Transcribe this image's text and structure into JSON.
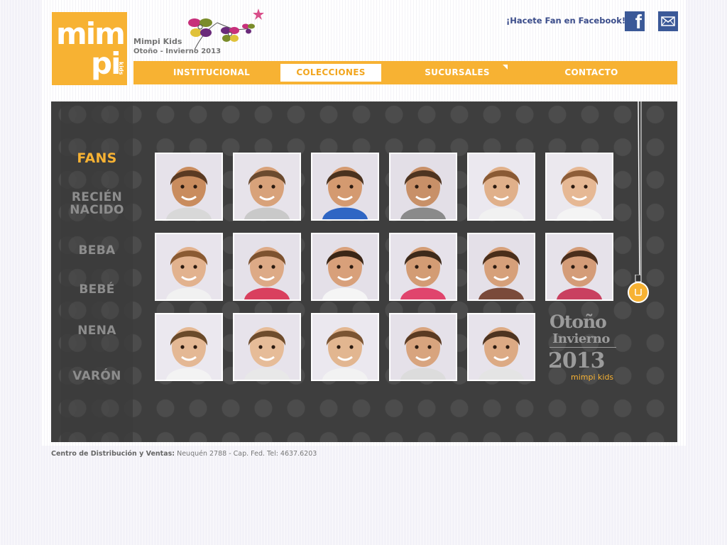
{
  "brand": {
    "logo_top": "mim",
    "logo_bottom": "pi",
    "logo_kids": "kids",
    "name": "Mimpi Kids",
    "season": "Otoño - Invierno 2013"
  },
  "social": {
    "facebook_text": "¡Hacete Fan en Facebook!",
    "facebook_icon": "f"
  },
  "nav": {
    "items": [
      {
        "label": "INSTITUCIONAL"
      },
      {
        "label": "COLECCIONES"
      },
      {
        "label": "SUCURSALES"
      },
      {
        "label": "CONTACTO"
      }
    ],
    "active_index": 1
  },
  "sidebar": {
    "items": [
      {
        "label": "FANS"
      },
      {
        "label": "RECIÉN"
      },
      {
        "label": "NACIDO"
      },
      {
        "label": "BEBA"
      },
      {
        "label": "BEBÉ"
      },
      {
        "label": "NENA"
      },
      {
        "label": "VARÓN"
      }
    ],
    "active_index": 0
  },
  "gallery": {
    "rows": 3,
    "photos": [
      {
        "tone": "#c98c5e",
        "hair": "#5a3a22",
        "bg": "#e6e2ea",
        "shirt": "#d8d8d8"
      },
      {
        "tone": "#d8a27a",
        "hair": "#6b4a2e",
        "bg": "#e7e3ea",
        "shirt": "#c9c9c9"
      },
      {
        "tone": "#d49a70",
        "hair": "#4a321e",
        "bg": "#e4e0e8",
        "shirt": "#2f66c4"
      },
      {
        "tone": "#c89068",
        "hair": "#4e3420",
        "bg": "#e3dfe7",
        "shirt": "#8a8a8a"
      },
      {
        "tone": "#e0b08a",
        "hair": "#8a5a34",
        "bg": "#ebe8ef",
        "shirt": "#f1f1f1"
      },
      {
        "tone": "#e6b894",
        "hair": "#8d5d38",
        "bg": "#ebe8ee",
        "shirt": "#f4f4f4"
      },
      {
        "tone": "#e2b28e",
        "hair": "#8a5a32",
        "bg": "#e8e4ec",
        "shirt": "#f1f1f1"
      },
      {
        "tone": "#ddaa86",
        "hair": "#7d522f",
        "bg": "#e5e1e9",
        "shirt": "#d9405e"
      },
      {
        "tone": "#d8a07a",
        "hair": "#3a2616",
        "bg": "#e4e0e8",
        "shirt": "#f5f5f5"
      },
      {
        "tone": "#d39c74",
        "hair": "#3e2a1a",
        "bg": "#e6e2ea",
        "shirt": "#e0456d"
      },
      {
        "tone": "#d6a07a",
        "hair": "#4a2e1a",
        "bg": "#e4e0e8",
        "shirt": "#7a4a3a"
      },
      {
        "tone": "#d49c78",
        "hair": "#4a2e1c",
        "bg": "#e6e2ea",
        "shirt": "#c94060"
      },
      {
        "tone": "#e4b894",
        "hair": "#6a4a2a",
        "bg": "#ebe8ef",
        "shirt": "#f3f3f3"
      },
      {
        "tone": "#e6bc98",
        "hair": "#6e4c2c",
        "bg": "#e7e3eb",
        "shirt": "#e8e8e8"
      },
      {
        "tone": "#e2b690",
        "hair": "#7a5432",
        "bg": "#ebe8ef",
        "shirt": "#f2f2f2"
      },
      {
        "tone": "#d8a47e",
        "hair": "#5a3a22",
        "bg": "#e5e1e9",
        "shirt": "#dcdcdc"
      },
      {
        "tone": "#dcaa84",
        "hair": "#4e3420",
        "bg": "#e7e3eb",
        "shirt": "#e4e4e4"
      }
    ]
  },
  "season_badge": {
    "line1": "Otoño",
    "line2": "Invierno",
    "line3": "2013",
    "line4": "mimpi kids"
  },
  "footer": {
    "label": "Centro de Distribución y Ventas:",
    "address": "Neuquén 2788 - Cap. Fed. Tel: 4637.6203"
  },
  "colors": {
    "accent": "#f7b233",
    "facebook": "#3b5998",
    "hero_bg": "#3e3e3e"
  }
}
